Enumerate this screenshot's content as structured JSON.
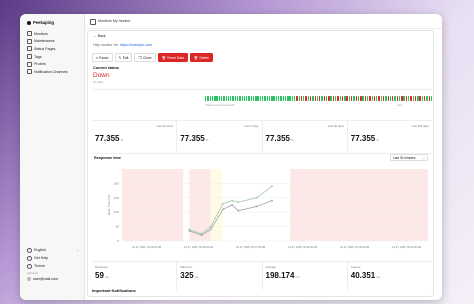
{
  "brand": {
    "name": "Peekaping"
  },
  "sidebar": {
    "items": [
      {
        "label": "Monitors",
        "icon": "activity-icon"
      },
      {
        "label": "Maintenance",
        "icon": "wrench-icon"
      },
      {
        "label": "Status Pages",
        "icon": "file-icon"
      },
      {
        "label": "Tags",
        "icon": "tag-icon"
      },
      {
        "label": "Proxies",
        "icon": "network-icon"
      },
      {
        "label": "Notification Channels",
        "icon": "bell-icon"
      }
    ],
    "language": "English",
    "help": "Get Help",
    "theme": "Theme",
    "account_label": "Account",
    "user": "user@mail.com"
  },
  "topbar": {
    "breadcrumb": "Monitors  My monitor"
  },
  "monitor": {
    "back_label": "Back",
    "url_prefix": "Http monitor for: ",
    "url": "https://example.com",
    "actions": [
      "Pause",
      "Edit",
      "Clone",
      "Reset Data",
      "Delete"
    ],
    "current_status_label": "Current status",
    "current_status": "Down",
    "status_sub": "No data",
    "beats_caption_left": "Check every 60 seconds",
    "beats_caption_right": "now"
  },
  "stats": [
    {
      "label": "Last 24 hours",
      "value": "77.355",
      "unit": "%"
    },
    {
      "label": "Last 7 days",
      "value": "77.355",
      "unit": "%"
    },
    {
      "label": "Last 30 days",
      "value": "77.355",
      "unit": "%"
    },
    {
      "label": "Last 365 days",
      "value": "77.355",
      "unit": "%"
    }
  ],
  "response": {
    "title": "Response time",
    "range": "Last 30 minutes"
  },
  "stats2": [
    {
      "label": "Response",
      "value": "59",
      "unit": "ms"
    },
    {
      "label": "Maximum",
      "value": "325",
      "unit": "ms"
    },
    {
      "label": "Average",
      "value": "198.174",
      "unit": "ms"
    },
    {
      "label": "Latency",
      "value": "40.351",
      "unit": "ms"
    }
  ],
  "notifications_title": "Important Notifications",
  "colors": {
    "down": "#dc2626",
    "up": "#22c55e",
    "accent": "#2563eb"
  },
  "beats": [
    "up",
    "up",
    "up",
    "up",
    "up",
    "up",
    "up",
    "up",
    "up",
    "up",
    "up",
    "up",
    "up",
    "up",
    "up",
    "up",
    "up",
    "up",
    "up",
    "up",
    "up",
    "up",
    "up",
    "up",
    "up",
    "up",
    "up",
    "up",
    "up",
    "up",
    "up",
    "up",
    "up",
    "up",
    "up",
    "up",
    "up",
    "up",
    "up",
    "up",
    "down",
    "up",
    "down",
    "up",
    "down",
    "up",
    "down",
    "up",
    "down",
    "up",
    "down",
    "up",
    "down",
    "up",
    "down",
    "up",
    "down",
    "up",
    "down",
    "up",
    "down",
    "up",
    "down",
    "up",
    "down",
    "up",
    "down",
    "up",
    "down",
    "up",
    "down",
    "up",
    "down",
    "up",
    "down",
    "up",
    "down",
    "up",
    "down",
    "up",
    "down",
    "up",
    "down",
    "up",
    "down",
    "up",
    "down",
    "up",
    "down",
    "up",
    "down",
    "up",
    "down",
    "up",
    "down",
    "up",
    "down",
    "up",
    "down",
    "up"
  ],
  "chart_data": {
    "type": "line",
    "ylabel": "Resp. Time (ms)",
    "ylim": [
      0,
      250
    ],
    "yticks": [
      0,
      50,
      100,
      150,
      200
    ],
    "xticks": [
      "Jul 27, 2025, 09:15:00 AM",
      "Jul 27, 2025, 09:16:00 AM",
      "Jul 27, 2025, 09:17:00 AM",
      "Jul 27, 2025, 09:18:00 AM",
      "Jul 27, 2025, 09:19:00 AM",
      "Jul 27, 2025, 09:20:00 AM"
    ],
    "series": [
      {
        "name": "avg",
        "x": [
          0.22,
          0.26,
          0.29,
          0.33,
          0.36,
          0.38,
          0.44,
          0.49
        ],
        "values": [
          35,
          20,
          40,
          110,
          125,
          105,
          120,
          140
        ]
      },
      {
        "name": "max",
        "x": [
          0.22,
          0.26,
          0.29,
          0.33,
          0.36,
          0.38,
          0.44,
          0.49
        ],
        "values": [
          40,
          25,
          50,
          130,
          140,
          135,
          150,
          190
        ]
      }
    ]
  }
}
